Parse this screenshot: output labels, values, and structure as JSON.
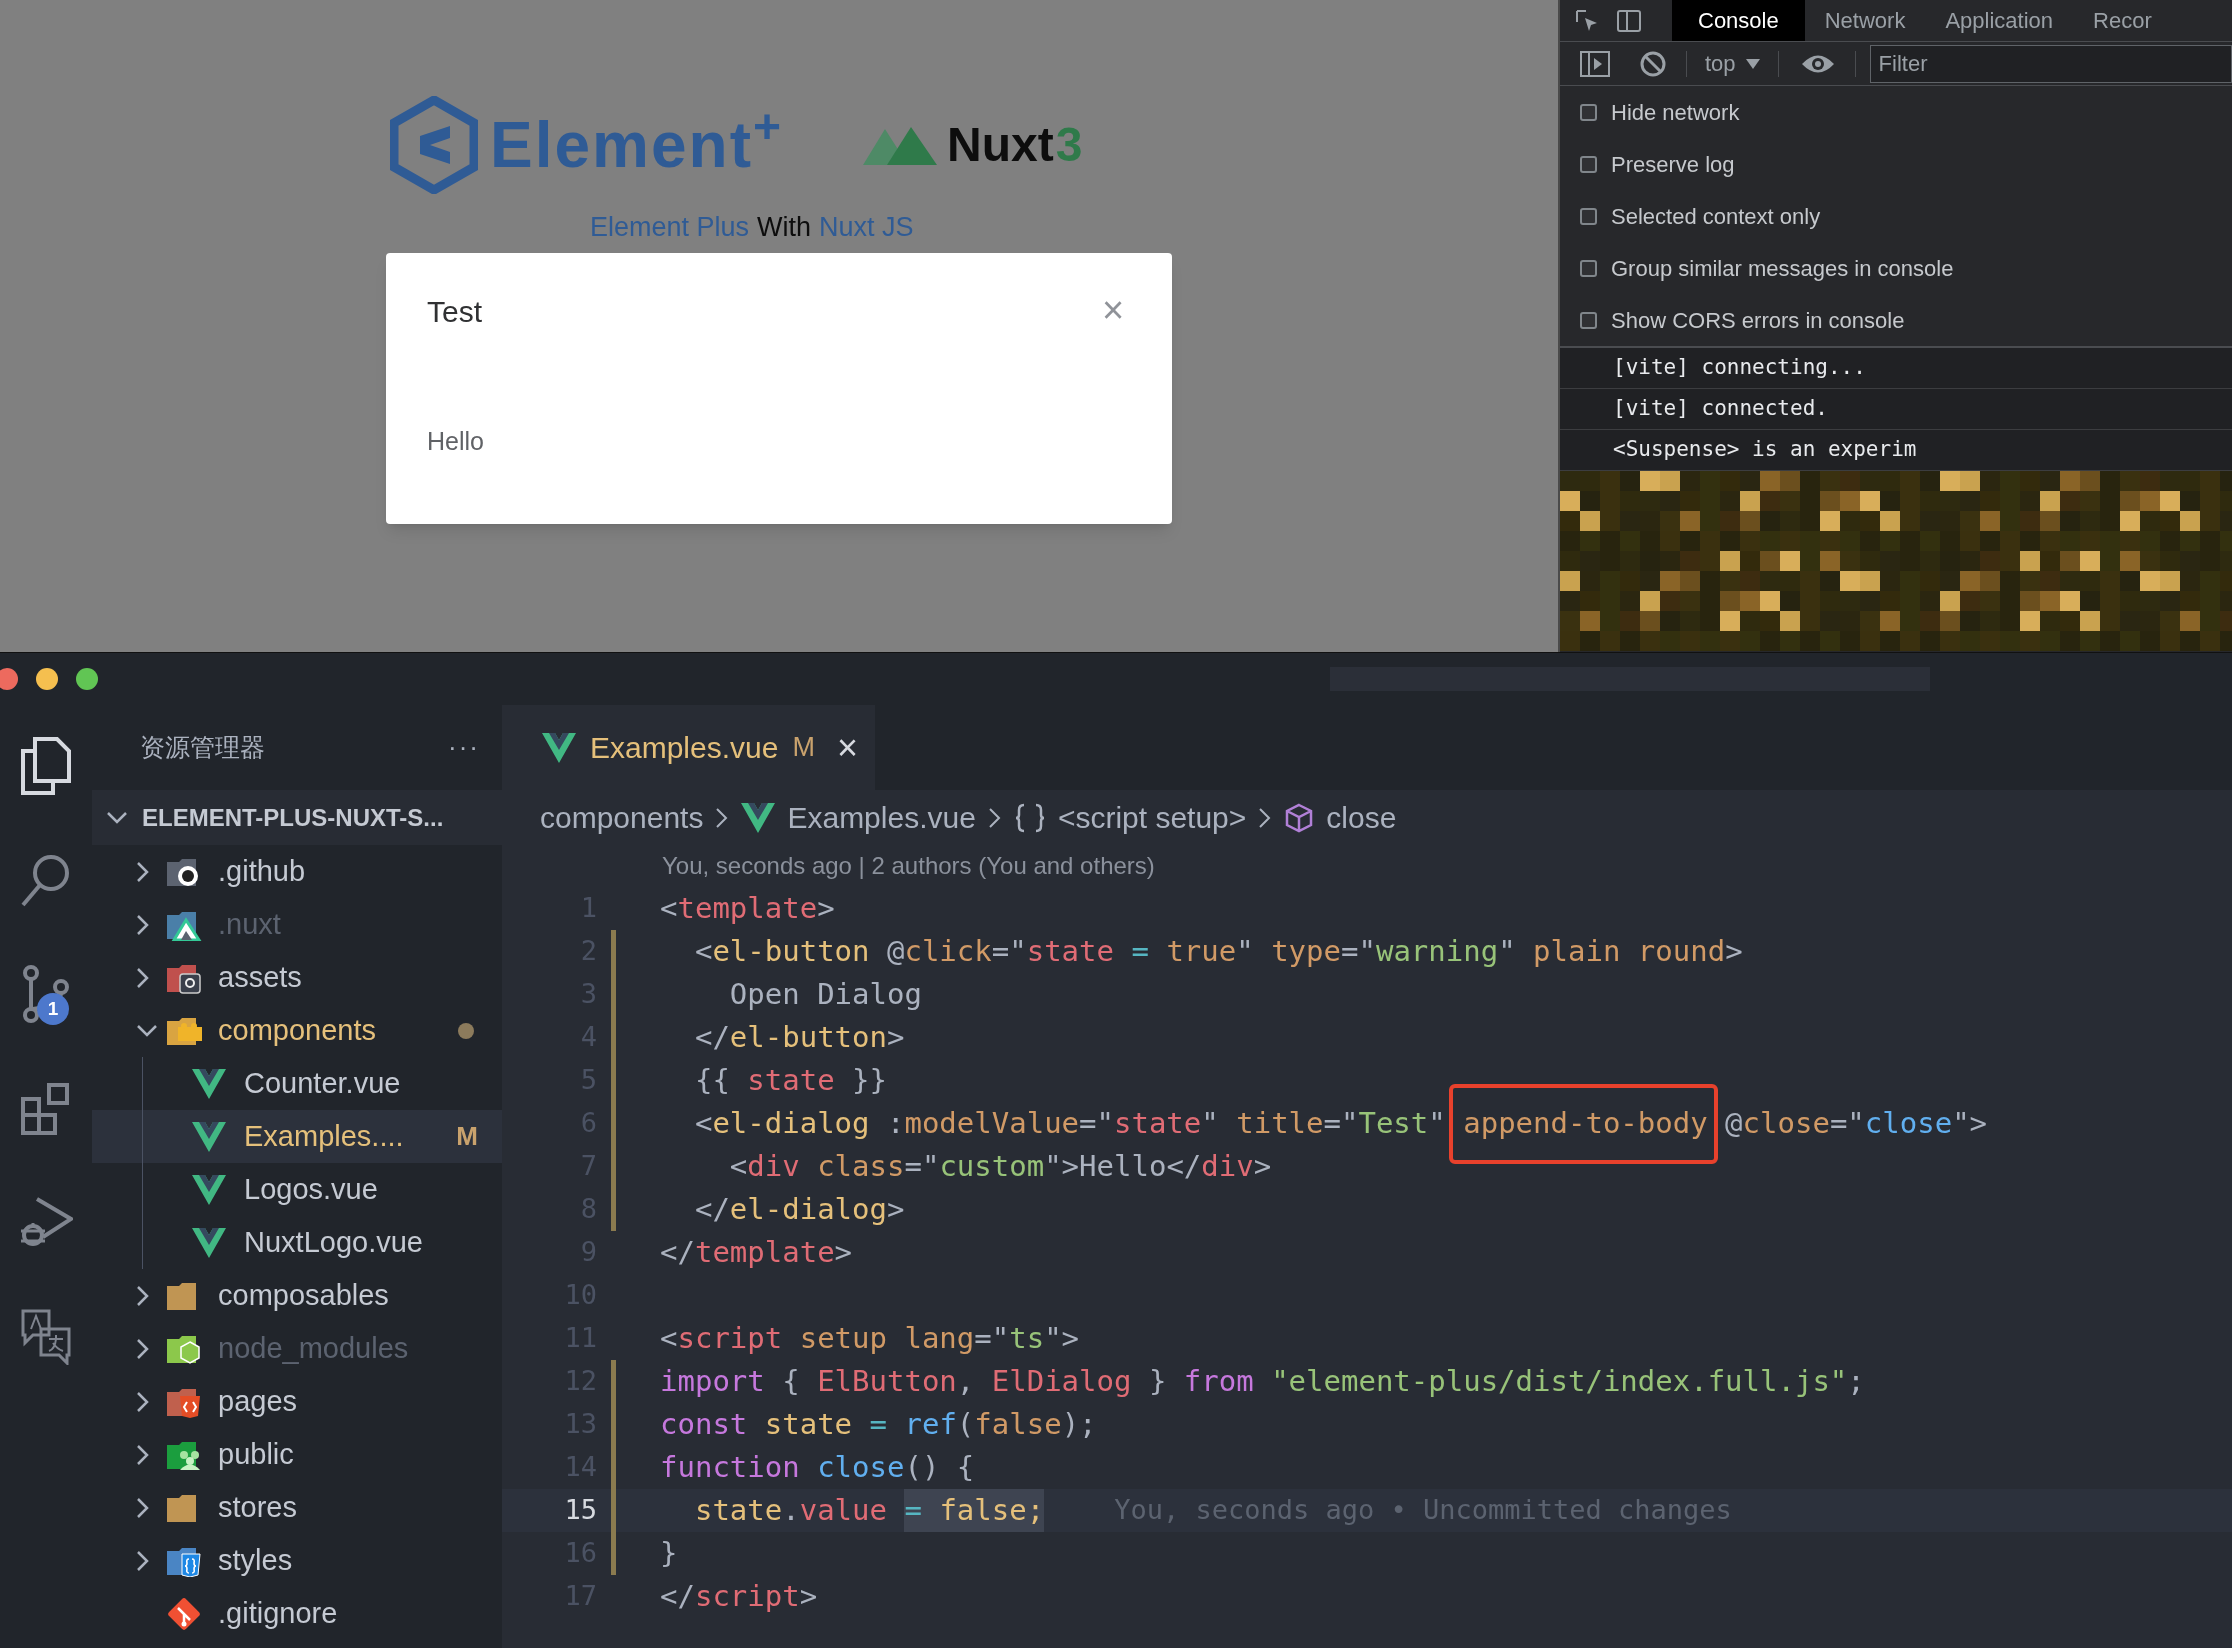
{
  "browser": {
    "logo_element": {
      "name": "Element",
      "mark": "+"
    },
    "logo_nuxt": {
      "name": "Nuxt",
      "version": "3"
    },
    "subtitle": {
      "link_1": "Element Plus",
      "middle": "With",
      "link_2": "Nuxt JS"
    },
    "dialog": {
      "title": "Test",
      "close": "×",
      "body": "Hello"
    }
  },
  "devtools": {
    "tabs": [
      {
        "label": "Console",
        "selected": true
      },
      {
        "label": "Network",
        "selected": false
      },
      {
        "label": "Application",
        "selected": false
      },
      {
        "label": "Recor",
        "selected": false
      }
    ],
    "context": "top",
    "filter": {
      "placeholder": "Filter"
    },
    "settings": [
      {
        "label": "Hide network",
        "checked": false
      },
      {
        "label": "Preserve log",
        "checked": false
      },
      {
        "label": "Selected context only",
        "checked": false
      },
      {
        "label": "Group similar messages in console",
        "checked": false
      },
      {
        "label": "Show CORS errors in console",
        "checked": false
      }
    ],
    "messages": [
      {
        "text": "[vite] connecting..."
      },
      {
        "text": "[vite] connected."
      },
      {
        "text": "<Suspense> is an experim"
      }
    ]
  },
  "activity_bar": [
    {
      "kind": "files",
      "selected": true
    },
    {
      "kind": "search",
      "selected": false
    },
    {
      "kind": "source-control",
      "selected": false,
      "badge": "1"
    },
    {
      "kind": "extensions",
      "selected": false
    },
    {
      "kind": "debug",
      "selected": false
    },
    {
      "kind": "translate",
      "selected": false
    }
  ],
  "explorer": {
    "title": "资源管理器",
    "more": "···",
    "root": "ELEMENT-PLUS-NUXT-S...",
    "items": [
      {
        "label": ".github",
        "kind": "github",
        "expanded": false,
        "selected": false,
        "ignored": false,
        "modified": false
      },
      {
        "label": ".nuxt",
        "kind": "nuxt",
        "expanded": false,
        "selected": false,
        "ignored": true,
        "modified": false
      },
      {
        "label": "assets",
        "kind": "assets",
        "expanded": false,
        "selected": false,
        "ignored": false,
        "modified": false
      },
      {
        "label": "components",
        "kind": "components",
        "expanded": true,
        "selected": false,
        "ignored": false,
        "modified": true,
        "children": [
          {
            "label": "Counter.vue",
            "kind": "vue",
            "selected": false,
            "ignored": false,
            "modified": false
          },
          {
            "label": "Examples....",
            "kind": "vue",
            "selected": true,
            "ignored": false,
            "modified": true,
            "badge": "M"
          },
          {
            "label": "Logos.vue",
            "kind": "vue",
            "selected": false,
            "ignored": false,
            "modified": false
          },
          {
            "label": "NuxtLogo.vue",
            "kind": "vue",
            "selected": false,
            "ignored": false,
            "modified": false
          }
        ]
      },
      {
        "label": "composables",
        "kind": "folder",
        "expanded": false,
        "selected": false,
        "ignored": false,
        "modified": false
      },
      {
        "label": "node_modules",
        "kind": "node",
        "expanded": false,
        "selected": false,
        "ignored": true,
        "modified": false
      },
      {
        "label": "pages",
        "kind": "pages",
        "expanded": false,
        "selected": false,
        "ignored": false,
        "modified": false
      },
      {
        "label": "public",
        "kind": "public",
        "expanded": false,
        "selected": false,
        "ignored": false,
        "modified": false
      },
      {
        "label": "stores",
        "kind": "folder",
        "expanded": false,
        "selected": false,
        "ignored": false,
        "modified": false
      },
      {
        "label": "styles",
        "kind": "styles",
        "expanded": false,
        "selected": false,
        "ignored": false,
        "modified": false
      },
      {
        "label": ".gitignore",
        "kind": "git",
        "selected": false,
        "ignored": false,
        "modified": false
      }
    ]
  },
  "editor": {
    "tab": {
      "label": "Examples.vue",
      "badge": "M",
      "close": "×"
    },
    "breadcrumb": [
      {
        "label": "components",
        "kind": "folder"
      },
      {
        "label": "Examples.vue",
        "kind": "vue"
      },
      {
        "label": "<script setup>",
        "kind": "object"
      },
      {
        "label": "close",
        "kind": "method"
      }
    ],
    "blame_header": "You, seconds ago | 2 authors (You and others)",
    "lines": [
      {
        "number": "1",
        "modified": false,
        "current": false,
        "tokens": [
          {
            "text": "<",
            "kind": "punct"
          },
          {
            "text": "template",
            "kind": "tag"
          },
          {
            "text": ">",
            "kind": "punct"
          }
        ]
      },
      {
        "number": "2",
        "modified": true,
        "current": false,
        "tokens": [
          {
            "text": "  <",
            "kind": "punct"
          },
          {
            "text": "el-button",
            "kind": "comp"
          },
          {
            "text": " @",
            "kind": "punct"
          },
          {
            "text": "click",
            "kind": "attr"
          },
          {
            "text": "=\"",
            "kind": "punct"
          },
          {
            "text": "state",
            "kind": "var"
          },
          {
            "text": " = ",
            "kind": "op"
          },
          {
            "text": "true",
            "kind": "bool"
          },
          {
            "text": "\"",
            "kind": "punct"
          },
          {
            "text": " type",
            "kind": "attr"
          },
          {
            "text": "=\"",
            "kind": "punct"
          },
          {
            "text": "warning",
            "kind": "str"
          },
          {
            "text": "\"",
            "kind": "punct"
          },
          {
            "text": " plain round",
            "kind": "attr"
          },
          {
            "text": ">",
            "kind": "punct"
          }
        ]
      },
      {
        "number": "3",
        "modified": true,
        "current": false,
        "tokens": [
          {
            "text": "    Open Dialog",
            "kind": "plain"
          }
        ]
      },
      {
        "number": "4",
        "modified": true,
        "current": false,
        "tokens": [
          {
            "text": "  </",
            "kind": "punct"
          },
          {
            "text": "el-button",
            "kind": "comp"
          },
          {
            "text": ">",
            "kind": "punct"
          }
        ]
      },
      {
        "number": "5",
        "modified": true,
        "current": false,
        "tokens": [
          {
            "text": "  {{ ",
            "kind": "punct"
          },
          {
            "text": "state",
            "kind": "var"
          },
          {
            "text": " }}",
            "kind": "punct"
          }
        ]
      },
      {
        "number": "6",
        "modified": true,
        "current": false,
        "tokens": [
          {
            "text": "  <",
            "kind": "punct"
          },
          {
            "text": "el-dialog",
            "kind": "comp"
          },
          {
            "text": " :",
            "kind": "punct"
          },
          {
            "text": "modelValue",
            "kind": "attr"
          },
          {
            "text": "=\"",
            "kind": "punct"
          },
          {
            "text": "state",
            "kind": "var"
          },
          {
            "text": "\"",
            "kind": "punct"
          },
          {
            "text": " title",
            "kind": "attr"
          },
          {
            "text": "=\"",
            "kind": "punct"
          },
          {
            "text": "Test",
            "kind": "str"
          },
          {
            "text": "\" ",
            "kind": "punct"
          },
          {
            "text": "append-to-body",
            "kind": "attr",
            "boxed": true
          },
          {
            "text": " @",
            "kind": "punct"
          },
          {
            "text": "close",
            "kind": "attr"
          },
          {
            "text": "=\"",
            "kind": "punct"
          },
          {
            "text": "close",
            "kind": "fn"
          },
          {
            "text": "\">",
            "kind": "punct"
          }
        ]
      },
      {
        "number": "7",
        "modified": true,
        "current": false,
        "tokens": [
          {
            "text": "    <",
            "kind": "punct"
          },
          {
            "text": "div",
            "kind": "tag"
          },
          {
            "text": " class",
            "kind": "attr"
          },
          {
            "text": "=\"",
            "kind": "punct"
          },
          {
            "text": "custom",
            "kind": "str"
          },
          {
            "text": "\">",
            "kind": "punct"
          },
          {
            "text": "Hello",
            "kind": "plain"
          },
          {
            "text": "</",
            "kind": "punct"
          },
          {
            "text": "div",
            "kind": "tag"
          },
          {
            "text": ">",
            "kind": "punct"
          }
        ]
      },
      {
        "number": "8",
        "modified": true,
        "current": false,
        "tokens": [
          {
            "text": "  </",
            "kind": "punct"
          },
          {
            "text": "el-dialog",
            "kind": "comp"
          },
          {
            "text": ">",
            "kind": "punct"
          }
        ]
      },
      {
        "number": "9",
        "modified": false,
        "current": false,
        "tokens": [
          {
            "text": "</",
            "kind": "punct"
          },
          {
            "text": "template",
            "kind": "tag"
          },
          {
            "text": ">",
            "kind": "punct"
          }
        ]
      },
      {
        "number": "10",
        "modified": false,
        "current": false
      },
      {
        "number": "11",
        "modified": false,
        "current": false,
        "tokens": [
          {
            "text": "<",
            "kind": "punct"
          },
          {
            "text": "script",
            "kind": "tag"
          },
          {
            "text": " setup lang",
            "kind": "attr"
          },
          {
            "text": "=\"",
            "kind": "punct"
          },
          {
            "text": "ts",
            "kind": "str"
          },
          {
            "text": "\">",
            "kind": "punct"
          }
        ]
      },
      {
        "number": "12",
        "modified": true,
        "current": false,
        "tokens": [
          {
            "text": "import",
            "kind": "kw"
          },
          {
            "text": " { ",
            "kind": "punct"
          },
          {
            "text": "ElButton",
            "kind": "var"
          },
          {
            "text": ", ",
            "kind": "punct"
          },
          {
            "text": "ElDialog",
            "kind": "var"
          },
          {
            "text": " } ",
            "kind": "punct"
          },
          {
            "text": "from",
            "kind": "kw"
          },
          {
            "text": " \"element-plus/dist/index.full.js\"",
            "kind": "str"
          },
          {
            "text": ";",
            "kind": "punct"
          }
        ]
      },
      {
        "number": "13",
        "modified": true,
        "current": false,
        "tokens": [
          {
            "text": "const",
            "kind": "kw"
          },
          {
            "text": " state",
            "kind": "ident"
          },
          {
            "text": " = ",
            "kind": "op"
          },
          {
            "text": "ref",
            "kind": "fn"
          },
          {
            "text": "(",
            "kind": "punct"
          },
          {
            "text": "false",
            "kind": "bool"
          },
          {
            "text": ");",
            "kind": "punct"
          }
        ]
      },
      {
        "number": "14",
        "modified": true,
        "current": false,
        "tokens": [
          {
            "text": "function",
            "kind": "kw"
          },
          {
            "text": " close",
            "kind": "fn"
          },
          {
            "text": "() {",
            "kind": "punct"
          }
        ]
      },
      {
        "number": "15",
        "modified": true,
        "current": true,
        "blame": "You, seconds ago • Uncommitted changes",
        "tokens": [
          {
            "text": "  state",
            "kind": "ident",
            "selected": false
          },
          {
            "text": ".",
            "kind": "punct",
            "selected": false
          },
          {
            "text": "value ",
            "kind": "var",
            "selected": false
          },
          {
            "text": "=",
            "kind": "op",
            "selected": true
          },
          {
            "text": " false;",
            "kind": "ident",
            "selected": true
          }
        ]
      },
      {
        "number": "16",
        "modified": true,
        "current": false,
        "tokens": [
          {
            "text": "}",
            "kind": "punct"
          }
        ]
      },
      {
        "number": "17",
        "modified": false,
        "current": false,
        "tokens": [
          {
            "text": "</",
            "kind": "punct"
          },
          {
            "text": "script",
            "kind": "tag"
          },
          {
            "text": ">",
            "kind": "punct"
          }
        ]
      }
    ]
  }
}
